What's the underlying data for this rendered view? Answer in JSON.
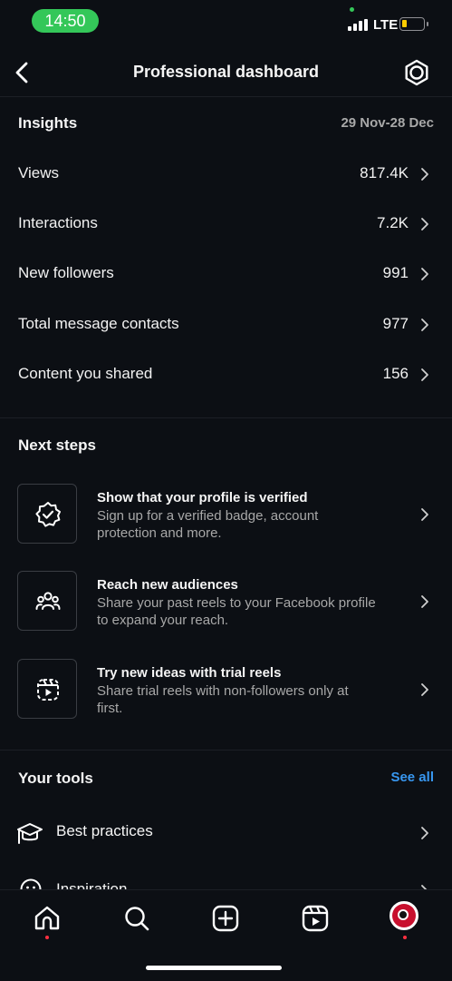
{
  "status_bar": {
    "time": "14:50",
    "network": "LTE"
  },
  "header": {
    "title": "Professional dashboard"
  },
  "insights": {
    "title": "Insights",
    "date_range": "29 Nov-28 Dec",
    "rows": [
      {
        "label": "Views",
        "value": "817.4K"
      },
      {
        "label": "Interactions",
        "value": "7.2K"
      },
      {
        "label": "New followers",
        "value": "991"
      },
      {
        "label": "Total message contacts",
        "value": "977"
      },
      {
        "label": "Content you shared",
        "value": "156"
      }
    ]
  },
  "next_steps": {
    "title": "Next steps",
    "items": [
      {
        "title": "Show that your profile is verified",
        "desc": "Sign up for a verified badge, account protection and more.",
        "icon": "verified-badge-icon"
      },
      {
        "title": "Reach new audiences",
        "desc": "Share your past reels to your Facebook profile to expand your reach.",
        "icon": "people-icon"
      },
      {
        "title": "Try new ideas with trial reels",
        "desc": "Share trial reels with non-followers only at first.",
        "icon": "trial-reels-icon"
      }
    ]
  },
  "tools": {
    "title": "Your tools",
    "see_all": "See all",
    "items": [
      {
        "label": "Best practices",
        "icon": "graduation-cap-icon"
      },
      {
        "label": "Inspiration",
        "icon": "smile-icon"
      }
    ]
  },
  "tab_bar": {
    "tabs": [
      "home-icon",
      "search-icon",
      "create-icon",
      "reels-icon",
      "profile-avatar"
    ]
  },
  "colors": {
    "accent": "#3897f0",
    "background": "#0c0f14",
    "status_pill": "#34c759"
  }
}
